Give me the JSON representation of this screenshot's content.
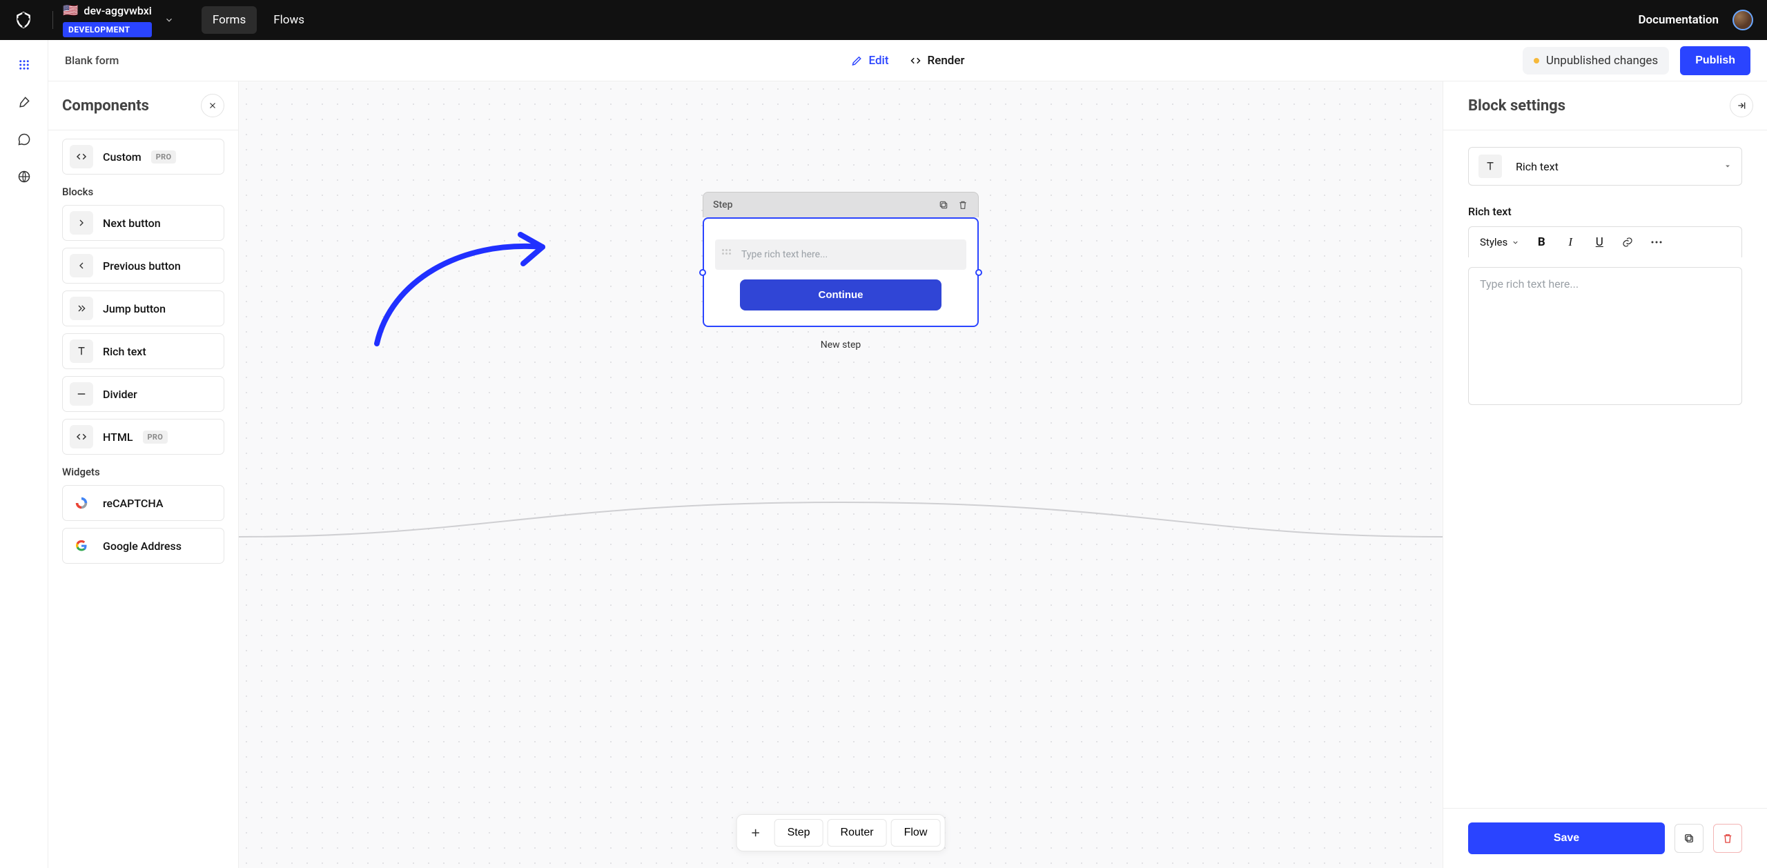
{
  "topbar": {
    "tenant_flag": "🇺🇸",
    "tenant_name": "dev-aggvwbxi",
    "tenant_env": "DEVELOPMENT",
    "tabs": {
      "forms": "Forms",
      "flows": "Flows"
    },
    "documentation": "Documentation"
  },
  "subbar": {
    "form_name": "Blank form",
    "edit": "Edit",
    "render": "Render",
    "status": "Unpublished changes",
    "publish": "Publish"
  },
  "components": {
    "title": "Components",
    "custom": "Custom",
    "pro": "PRO",
    "section_blocks": "Blocks",
    "next_button": "Next button",
    "previous_button": "Previous button",
    "jump_button": "Jump button",
    "rich_text": "Rich text",
    "divider": "Divider",
    "html": "HTML",
    "section_widgets": "Widgets",
    "recaptcha": "reCAPTCHA",
    "google_address": "Google Address"
  },
  "canvas": {
    "step_title": "Step",
    "rich_placeholder": "Type rich text here...",
    "continue": "Continue",
    "caption": "New step",
    "toolbar": {
      "step": "Step",
      "router": "Router",
      "flow": "Flow"
    }
  },
  "settings": {
    "title": "Block settings",
    "block_type": "Rich text",
    "field_label": "Rich text",
    "styles": "Styles",
    "placeholder": "Type rich text here...",
    "save": "Save"
  }
}
